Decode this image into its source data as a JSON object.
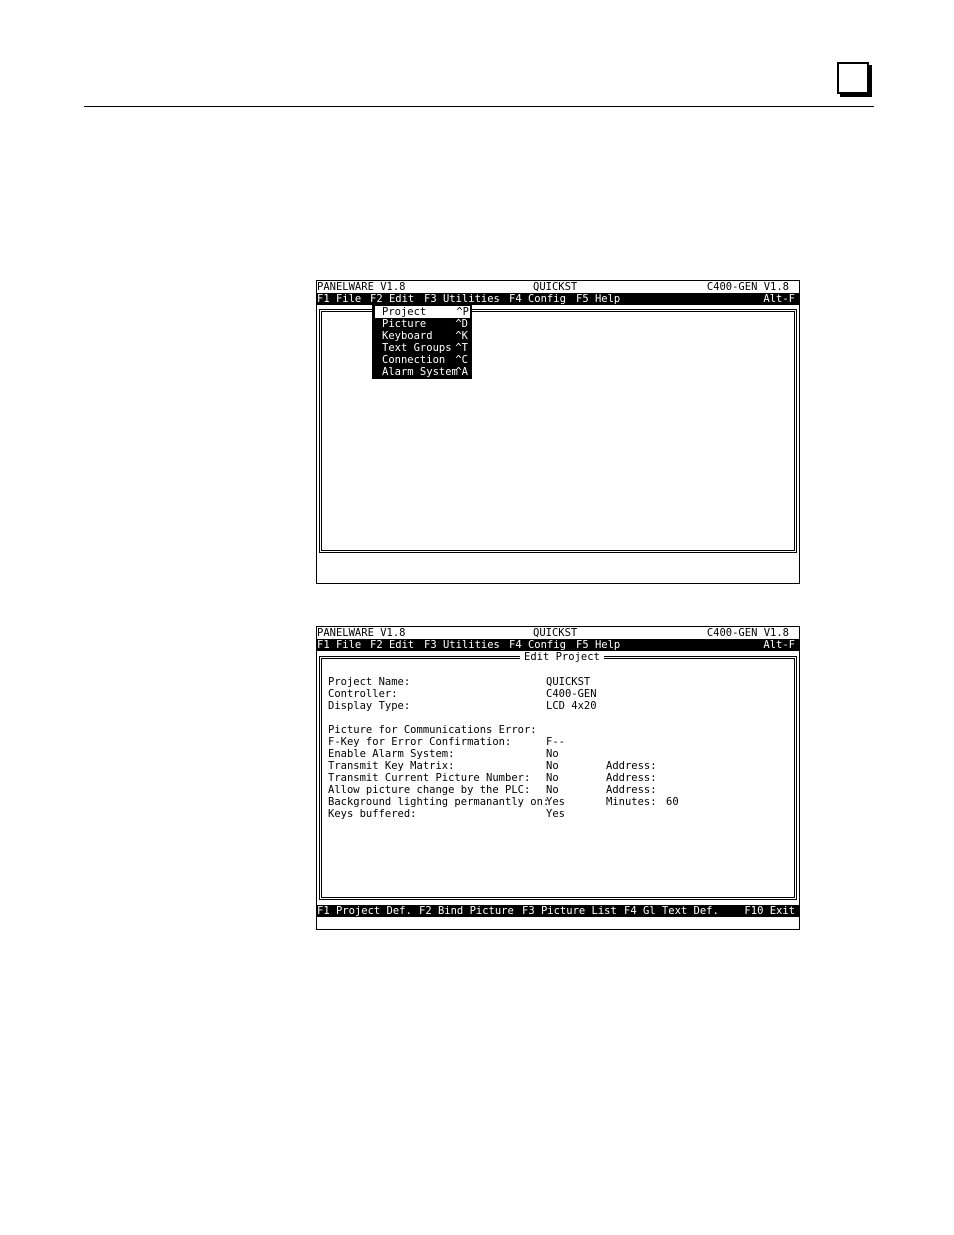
{
  "screen1": {
    "title_left": "PANELWARE V1.8",
    "title_center": "QUICKST",
    "title_right": "C400-GEN V1.8",
    "menu": [
      "F1 File",
      "F2 Edit",
      "F3 Utilities",
      "F4 Config",
      "F5 Help"
    ],
    "menu_right": "Alt-F",
    "dropdown": [
      {
        "label": "Project",
        "shortcut": "^P"
      },
      {
        "label": "Picture",
        "shortcut": "^D"
      },
      {
        "label": "Keyboard",
        "shortcut": "^K"
      },
      {
        "label": "Text Groups",
        "shortcut": "^T"
      },
      {
        "label": "Connection",
        "shortcut": "^C"
      },
      {
        "label": "Alarm System",
        "shortcut": "^A"
      }
    ]
  },
  "screen2": {
    "title_left": "PANELWARE V1.8",
    "title_center": "QUICKST",
    "title_right": "C400-GEN V1.8",
    "menu": [
      "F1 File",
      "F2 Edit",
      "F3 Utilities",
      "F4 Config",
      "F5 Help"
    ],
    "menu_right": "Alt-F",
    "dialog_title": "Edit Project",
    "fields": {
      "project_name": {
        "label": "Project Name:",
        "value": "QUICKST"
      },
      "controller": {
        "label": "Controller:",
        "value": "C400-GEN"
      },
      "display_type": {
        "label": "Display Type:",
        "value": "LCD 4x20"
      },
      "pic_comm_error": {
        "label": "Picture for Communications Error:",
        "value": ""
      },
      "fkey_error": {
        "label": "F-Key for Error Confirmation:",
        "value": "F--"
      },
      "alarm": {
        "label": "Enable Alarm System:",
        "value": "No"
      },
      "key_matrix": {
        "label": "Transmit Key Matrix:",
        "value": "No",
        "extra_label": "Address:"
      },
      "pic_number": {
        "label": "Transmit Current Picture Number:",
        "value": "No",
        "extra_label": "Address:"
      },
      "pic_change": {
        "label": "Allow picture change by the PLC:",
        "value": "No",
        "extra_label": "Address:"
      },
      "backlight": {
        "label": "Background lighting permanantly on:",
        "value": "Yes",
        "extra_label": "Minutes:",
        "extra_value": "60"
      },
      "keys_buffered": {
        "label": "Keys buffered:",
        "value": "Yes"
      }
    },
    "status": [
      "F1 Project Def.",
      "F2 Bind Picture",
      "F3 Picture List",
      "F4 Gl Text Def.",
      "F10 Exit"
    ]
  }
}
